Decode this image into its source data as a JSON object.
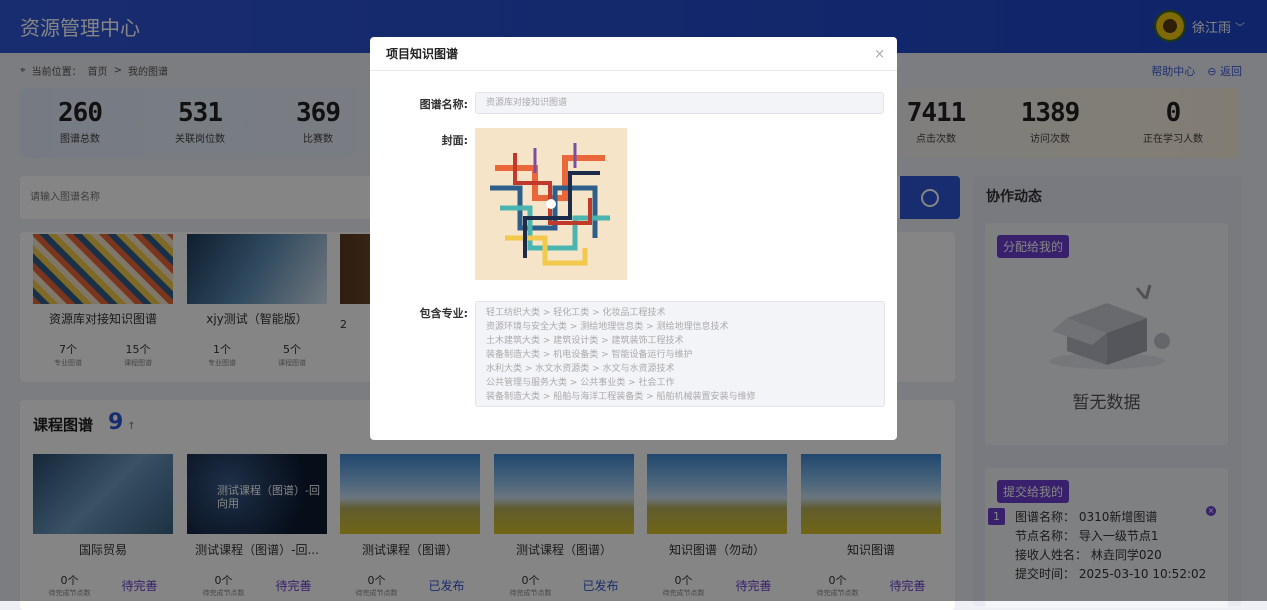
{
  "header": {
    "app_title": "资源管理中心",
    "user_name": "徐江雨",
    "user_chevron": "﹀"
  },
  "breadcrumb": {
    "prefix": "当前位置：",
    "home": "首页",
    "sep": ">",
    "current": "我的图谱"
  },
  "toplinks": {
    "help": "帮助中心",
    "back": "返回"
  },
  "stats": [
    {
      "value": "260",
      "label": "图谱总数"
    },
    {
      "value": "531",
      "label": "关联岗位数"
    },
    {
      "value": "369",
      "label": "比赛数"
    },
    {
      "value": "7411",
      "label": "点击次数"
    },
    {
      "value": "1389",
      "label": "访问次数"
    },
    {
      "value": "0",
      "label": "正在学习人数"
    }
  ],
  "search": {
    "placeholder": "请输入图谱名称"
  },
  "knowledge_cards": [
    {
      "title": "资源库对接知识图谱",
      "n1": "7个",
      "l1": "专业图谱",
      "n2": "15个",
      "l2": "课程图谱"
    },
    {
      "title": "xjy测试（智能版）",
      "n1": "1个",
      "l1": "专业图谱",
      "n2": "5个",
      "l2": "课程图谱"
    },
    {
      "title": "",
      "n1": "2",
      "l1": "",
      "n2": "",
      "l2": ""
    }
  ],
  "course": {
    "title": "课程图谱",
    "count": "9",
    "arrow": "↑"
  },
  "course_cards": [
    {
      "title": "国际贸易",
      "num": "0个",
      "numlbl": "待完成节点数",
      "status": "待完善",
      "status_type": "warn",
      "overlay": ""
    },
    {
      "title": "测试课程（图谱）-回...",
      "num": "0个",
      "numlbl": "待完成节点数",
      "status": "待完善",
      "status_type": "warn",
      "overlay": "测试课程（图谱）-回\n向用"
    },
    {
      "title": "测试课程（图谱）",
      "num": "0个",
      "numlbl": "待完成节点数",
      "status": "已发布",
      "status_type": "ok",
      "overlay": ""
    },
    {
      "title": "测试课程（图谱）",
      "num": "0个",
      "numlbl": "待完成节点数",
      "status": "已发布",
      "status_type": "ok",
      "overlay": ""
    },
    {
      "title": "知识图谱（勿动）",
      "num": "0个",
      "numlbl": "待完成节点数",
      "status": "待完善",
      "status_type": "warn",
      "overlay": ""
    },
    {
      "title": "知识图谱",
      "num": "0个",
      "numlbl": "待完成节点数",
      "status": "待完善",
      "status_type": "warn",
      "overlay": ""
    }
  ],
  "collab": {
    "title": "协作动态",
    "assigned_tag": "分配给我的",
    "empty_text": "暂无数据",
    "submitted_tag": "提交给我的",
    "item": {
      "index": "1",
      "map_name": "图谱名称：  0310新增图谱",
      "node_name": "节点名称：  导入一级节点1",
      "receiver": "接收人姓名：  林垚同学020",
      "submit_time": "提交时间：  2025-03-10 10:52:02"
    }
  },
  "modal": {
    "title": "项目知识图谱",
    "close": "×",
    "name_label": "图谱名称:",
    "name_value": "资源库对接知识图谱",
    "cover_label": "封面:",
    "majors_label": "包含专业:",
    "majors": [
      "轻工纺织大类 > 轻化工类 > 化妆品工程技术",
      "资源环境与安全大类 > 测绘地理信息类 > 测绘地理信息技术",
      "土木建筑大类 > 建筑设计类 > 建筑装饰工程技术",
      "装备制造大类 > 机电设备类 > 智能设备运行与维护",
      "水利大类 > 水文水资源类 > 水文与水资源技术",
      "公共管理与服务大类 > 公共事业类 > 社会工作",
      "装备制造大类 > 船舶与海洋工程装备类 > 船舶机械装置安装与维修"
    ]
  },
  "colors": {
    "primary": "#2f56d6",
    "purple": "#6b3fcf"
  }
}
